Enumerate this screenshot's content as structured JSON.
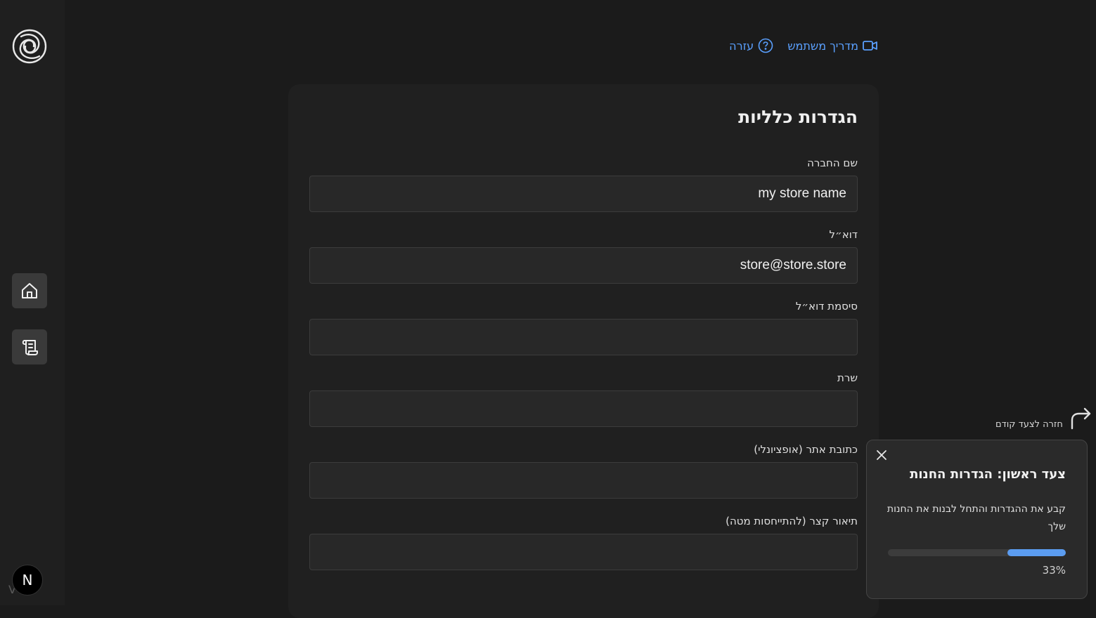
{
  "sidebar": {
    "logo_icon": "knot-logo-icon",
    "nav": [
      {
        "icon": "home-icon"
      },
      {
        "icon": "scroll-icon"
      }
    ],
    "version": "V 1.6",
    "badge_letter": "N"
  },
  "header": {
    "links": [
      {
        "label": "מדריך משתמש",
        "icon": "video-icon"
      },
      {
        "label": "עזרה",
        "icon": "help-circle-icon"
      }
    ],
    "accent": "#5aa0ff"
  },
  "form": {
    "title": "הגדרות כלליות",
    "fields": [
      {
        "label": "שם החברה",
        "value": "my store name"
      },
      {
        "label": "דוא״ל",
        "value": "store@store.store"
      },
      {
        "label": "סיסמת דוא״ל",
        "value": ""
      },
      {
        "label": "שרת",
        "value": ""
      },
      {
        "label": "כתובת אתר (אופציונלי)",
        "value": ""
      },
      {
        "label": "תיאור קצר (להתייחסות מטה)",
        "value": ""
      }
    ]
  },
  "tour": {
    "back_label": "חזרה לצעד קודם",
    "title": "צעד ראשון: הגדרות החנות",
    "description": "קבע את ההגדרות והתחל לבנות את החנות שלך",
    "progress": 33,
    "progress_text": "33%",
    "progress_color": "#5b9cf0"
  }
}
